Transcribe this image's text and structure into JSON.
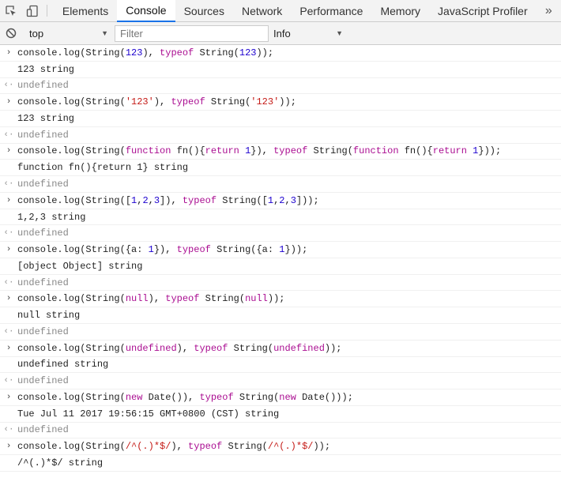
{
  "tabs": [
    "Elements",
    "Console",
    "Sources",
    "Network",
    "Performance",
    "Memory",
    "JavaScript Profiler"
  ],
  "active_tab": "Console",
  "toolbar": {
    "context": "top",
    "filter_placeholder": "Filter",
    "level": "Info"
  },
  "colors": {
    "keyword": "#aa0d91",
    "number": "#1c00cf",
    "string": "#c41a16",
    "active_tab_underline": "#1a73e8"
  },
  "lines": [
    {
      "kind": "input",
      "tokens": [
        [
          "t",
          "console.log(String("
        ],
        [
          "n",
          "123"
        ],
        [
          "t",
          "), "
        ],
        [
          "k",
          "typeof"
        ],
        [
          "t",
          " String("
        ],
        [
          "n",
          "123"
        ],
        [
          "t",
          "));"
        ]
      ]
    },
    {
      "kind": "output",
      "tokens": [
        [
          "t",
          "123 string"
        ]
      ]
    },
    {
      "kind": "result",
      "tokens": [
        [
          "t",
          "undefined"
        ]
      ]
    },
    {
      "kind": "input",
      "tokens": [
        [
          "t",
          "console.log(String("
        ],
        [
          "s",
          "'123'"
        ],
        [
          "t",
          "), "
        ],
        [
          "k",
          "typeof"
        ],
        [
          "t",
          " String("
        ],
        [
          "s",
          "'123'"
        ],
        [
          "t",
          "));"
        ]
      ]
    },
    {
      "kind": "output",
      "tokens": [
        [
          "t",
          "123 string"
        ]
      ]
    },
    {
      "kind": "result",
      "tokens": [
        [
          "t",
          "undefined"
        ]
      ]
    },
    {
      "kind": "input",
      "tokens": [
        [
          "t",
          "console.log(String("
        ],
        [
          "k",
          "function"
        ],
        [
          "t",
          " fn(){"
        ],
        [
          "k",
          "return"
        ],
        [
          "t",
          " "
        ],
        [
          "n",
          "1"
        ],
        [
          "t",
          "}), "
        ],
        [
          "k",
          "typeof"
        ],
        [
          "t",
          " String("
        ],
        [
          "k",
          "function"
        ],
        [
          "t",
          " fn(){"
        ],
        [
          "k",
          "return"
        ],
        [
          "t",
          " "
        ],
        [
          "n",
          "1"
        ],
        [
          "t",
          "}));"
        ]
      ]
    },
    {
      "kind": "output",
      "tokens": [
        [
          "t",
          "function fn(){return 1} string"
        ]
      ]
    },
    {
      "kind": "result",
      "tokens": [
        [
          "t",
          "undefined"
        ]
      ]
    },
    {
      "kind": "input",
      "tokens": [
        [
          "t",
          "console.log(String(["
        ],
        [
          "n",
          "1"
        ],
        [
          "t",
          ","
        ],
        [
          "n",
          "2"
        ],
        [
          "t",
          ","
        ],
        [
          "n",
          "3"
        ],
        [
          "t",
          "]), "
        ],
        [
          "k",
          "typeof"
        ],
        [
          "t",
          " String(["
        ],
        [
          "n",
          "1"
        ],
        [
          "t",
          ","
        ],
        [
          "n",
          "2"
        ],
        [
          "t",
          ","
        ],
        [
          "n",
          "3"
        ],
        [
          "t",
          "]));"
        ]
      ]
    },
    {
      "kind": "output",
      "tokens": [
        [
          "t",
          "1,2,3 string"
        ]
      ]
    },
    {
      "kind": "result",
      "tokens": [
        [
          "t",
          "undefined"
        ]
      ]
    },
    {
      "kind": "input",
      "tokens": [
        [
          "t",
          "console.log(String({a: "
        ],
        [
          "n",
          "1"
        ],
        [
          "t",
          "}), "
        ],
        [
          "k",
          "typeof"
        ],
        [
          "t",
          " String({a: "
        ],
        [
          "n",
          "1"
        ],
        [
          "t",
          "}));"
        ]
      ]
    },
    {
      "kind": "output",
      "tokens": [
        [
          "t",
          "[object Object] string"
        ]
      ]
    },
    {
      "kind": "result",
      "tokens": [
        [
          "t",
          "undefined"
        ]
      ]
    },
    {
      "kind": "input",
      "tokens": [
        [
          "t",
          "console.log(String("
        ],
        [
          "k",
          "null"
        ],
        [
          "t",
          "), "
        ],
        [
          "k",
          "typeof"
        ],
        [
          "t",
          " String("
        ],
        [
          "k",
          "null"
        ],
        [
          "t",
          "));"
        ]
      ]
    },
    {
      "kind": "output",
      "tokens": [
        [
          "t",
          "null string"
        ]
      ]
    },
    {
      "kind": "result",
      "tokens": [
        [
          "t",
          "undefined"
        ]
      ]
    },
    {
      "kind": "input",
      "tokens": [
        [
          "t",
          "console.log(String("
        ],
        [
          "k",
          "undefined"
        ],
        [
          "t",
          "), "
        ],
        [
          "k",
          "typeof"
        ],
        [
          "t",
          " String("
        ],
        [
          "k",
          "undefined"
        ],
        [
          "t",
          "));"
        ]
      ]
    },
    {
      "kind": "output",
      "tokens": [
        [
          "t",
          "undefined string"
        ]
      ]
    },
    {
      "kind": "result",
      "tokens": [
        [
          "t",
          "undefined"
        ]
      ]
    },
    {
      "kind": "input",
      "tokens": [
        [
          "t",
          "console.log(String("
        ],
        [
          "k",
          "new"
        ],
        [
          "t",
          " Date()), "
        ],
        [
          "k",
          "typeof"
        ],
        [
          "t",
          " String("
        ],
        [
          "k",
          "new"
        ],
        [
          "t",
          " Date()));"
        ]
      ]
    },
    {
      "kind": "output",
      "tokens": [
        [
          "t",
          "Tue Jul 11 2017 19:56:15 GMT+0800 (CST) string"
        ]
      ]
    },
    {
      "kind": "result",
      "tokens": [
        [
          "t",
          "undefined"
        ]
      ]
    },
    {
      "kind": "input",
      "tokens": [
        [
          "t",
          "console.log(String("
        ],
        [
          "s",
          "/^(.)*$/"
        ],
        [
          "t",
          "), "
        ],
        [
          "k",
          "typeof"
        ],
        [
          "t",
          " String("
        ],
        [
          "s",
          "/^(.)*$/"
        ],
        [
          "t",
          "));"
        ]
      ]
    },
    {
      "kind": "output",
      "tokens": [
        [
          "t",
          "/^(.)*$/ string"
        ]
      ]
    }
  ]
}
